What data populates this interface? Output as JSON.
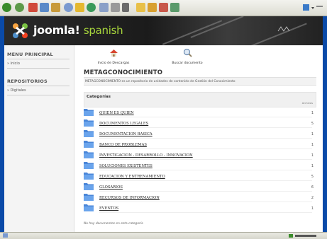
{
  "header": {
    "brand": "joomla!",
    "brand_suffix": "spanish"
  },
  "sidebar": {
    "menu_heading": "MENU PRINCIPAL",
    "menu_items": [
      {
        "label": "» Inicio"
      }
    ],
    "repos_heading": "REPOSITORIOS",
    "repos_items": [
      {
        "label": "» Digitales"
      }
    ]
  },
  "main": {
    "top_buttons": [
      {
        "label": "Inicio de Descargas",
        "icon": "home-icon"
      },
      {
        "label": "Buscar documento",
        "icon": "search-icon"
      }
    ],
    "title": "METAGCONOCIMIENTO",
    "description": "METAGCONOCIMIENTO es un repositorio de unidades de contenido de Gestión del Conocimiento",
    "categories_heading": "Categorías",
    "files_column": "Archivos",
    "categories": [
      {
        "name": "QUIEN ES QUIEN",
        "count": "1"
      },
      {
        "name": "DOCUMENTOS LEGALES",
        "count": "5"
      },
      {
        "name": "DOCUMENTACION BASICA",
        "count": "1"
      },
      {
        "name": "BANCO DE PROBLEMAS",
        "count": "1"
      },
      {
        "name": "INVESTIGACION - DESARROLLO - INNOVACION",
        "count": "1"
      },
      {
        "name": "SOLUCIONES EXISTENTES",
        "count": "1"
      },
      {
        "name": "EDUCACION Y ENTRENAMIENTO",
        "count": "5"
      },
      {
        "name": "GLOSARIOS",
        "count": "6"
      },
      {
        "name": "RECURSOS DE INFORMACION",
        "count": "2"
      },
      {
        "name": "EVENTOS",
        "count": "1"
      }
    ],
    "no_docs": "No hay documentos en esta categoría"
  },
  "colors": {
    "desktop": "#0a4aa8",
    "header": "#1b1b1b",
    "brand_accent": "#a8d63c",
    "folder": "#4a86d8"
  }
}
